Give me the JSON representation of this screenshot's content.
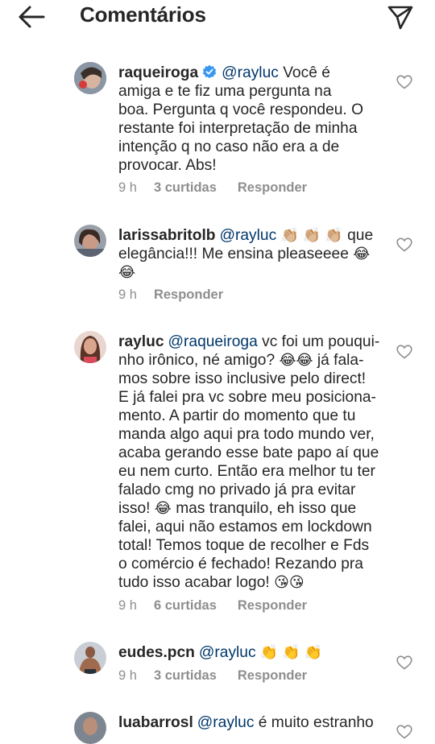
{
  "header": {
    "title": "Comentários"
  },
  "comments": [
    {
      "username": "raqueiroga",
      "mention": "@rayluc",
      "lines": [
        "Você é",
        "amiga e te fiz uma pergunta na",
        "boa. Pergunta q você respondeu. O",
        "restante foi interpretação de minha",
        "intenção q no caso não era a de",
        "provocar. Abs!"
      ],
      "time": "9 h",
      "likes": "3 curtidas",
      "reply": "Responder"
    },
    {
      "username": "larissabritolb",
      "mention": "@rayluc",
      "line1_emojis": "👏🏼 👏🏼 👏🏼",
      "line1_end": "que",
      "line2": "elegância!!! Me ensina pleaseeee",
      "line2_emoji": "😂",
      "line3_emoji": "😂",
      "time": "9 h",
      "reply": "Responder"
    },
    {
      "username": "rayluc",
      "mention": "@raqueiroga",
      "line1": "vc foi um pouqui-",
      "line2a": "nho irônico, né amigo?",
      "line2_emoji": "😂😂",
      "line2b": "já fala-",
      "line3": "mos sobre isso inclusive pelo direct!",
      "line4": "E já falei pra vc sobre meu posiciona-",
      "line5": "mento. A partir do momento que tu",
      "line6": "manda algo aqui pra todo mundo ver,",
      "line7": "acaba gerando esse bate papo aí que",
      "line8": "eu nem curto. Então era melhor tu ter",
      "line9": "falado cmg no privado já pra evitar",
      "line10a": "isso!",
      "line10_emoji": "😂",
      "line10b": "mas tranquilo, eh isso que",
      "line11": "falei, aqui não estamos em lockdown",
      "line12": "total! Temos toque de recolher e Fds",
      "line13": "o comércio é fechado! Rezando pra",
      "line14a": "tudo isso acabar logo!",
      "line14_emoji": "😘😘",
      "time": "9 h",
      "likes": "6 curtidas",
      "reply": "Responder"
    },
    {
      "username": "eudes.pcn",
      "mention": "@rayluc",
      "emojis": "👏 👏 👏",
      "time": "9 h",
      "likes": "3 curtidas",
      "reply": "Responder"
    },
    {
      "username": "luabarrosl",
      "mention": "@rayluc",
      "text": "é muito estranho"
    }
  ],
  "icons": {
    "back": "arrow-left-icon",
    "share": "paper-plane-icon",
    "like": "heart-outline-icon",
    "verified": "verified-badge-icon"
  },
  "colors": {
    "mention": "#00376b",
    "meta": "#8e8e8e",
    "verified": "#3897f0"
  }
}
